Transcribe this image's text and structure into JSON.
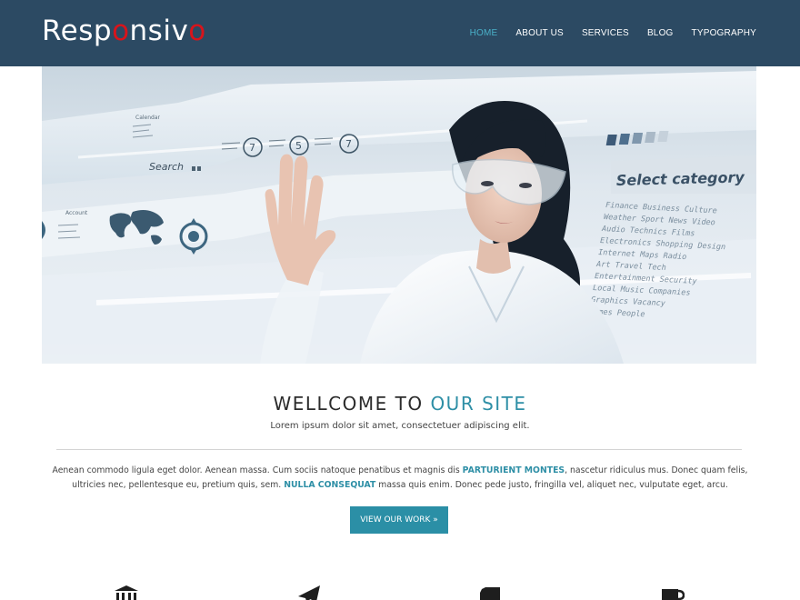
{
  "header": {
    "logo": {
      "part1": "Resp",
      "o1": "o",
      "part2": "nsiv",
      "o2": "o"
    },
    "nav": [
      {
        "label": "HOME",
        "active": true
      },
      {
        "label": "ABOUT US",
        "active": false
      },
      {
        "label": "SERVICES",
        "active": false
      },
      {
        "label": "BLOG",
        "active": false
      },
      {
        "label": "TYPOGRAPHY",
        "active": false
      }
    ]
  },
  "hero": {
    "ui_text": {
      "select_category": "Select category",
      "search": "Search",
      "calendar": "Calendar",
      "account": "Account",
      "categories": [
        "Finance Business Culture",
        "Weather Sport News Video",
        "Audio Technics Films",
        "Electronics Shopping Design",
        "Internet Maps Radio",
        "Art Travel Tech",
        "Entertainment Security",
        "Local Music Companies",
        "Graphics Vacancy",
        "Games People"
      ],
      "badges": [
        "7",
        "5",
        "7"
      ]
    }
  },
  "welcome": {
    "title_part1": "WELLCOME TO ",
    "title_part2": "OUR SITE",
    "subtitle": "Lorem ipsum dolor sit amet, consectetuer adipiscing elit.",
    "para_1": "Aenean commodo ligula eget dolor. Aenean massa. Cum sociis natoque penatibus et magnis dis ",
    "para_hl1": "PARTURIENT MONTES",
    "para_2": ", nascetur ridiculus mus. Donec quam felis, ultricies nec, pellentesque eu, pretium quis, sem. ",
    "para_hl2": "NULLA CONSEQUAT",
    "para_3": " massa quis enim. Donec pede justo, fringilla vel, aliquet nec, vulputate eget, arcu.",
    "button_label": "VIEW OUR WORK »"
  },
  "features": {
    "icons": [
      "bank-icon",
      "paper-plane-icon",
      "truck-icon",
      "coffee-cup-icon"
    ]
  },
  "colors": {
    "header_bg": "#2c4a63",
    "accent": "#2e8fa6",
    "logo_red": "#d8141b",
    "nav_active": "#4ab0c8"
  }
}
